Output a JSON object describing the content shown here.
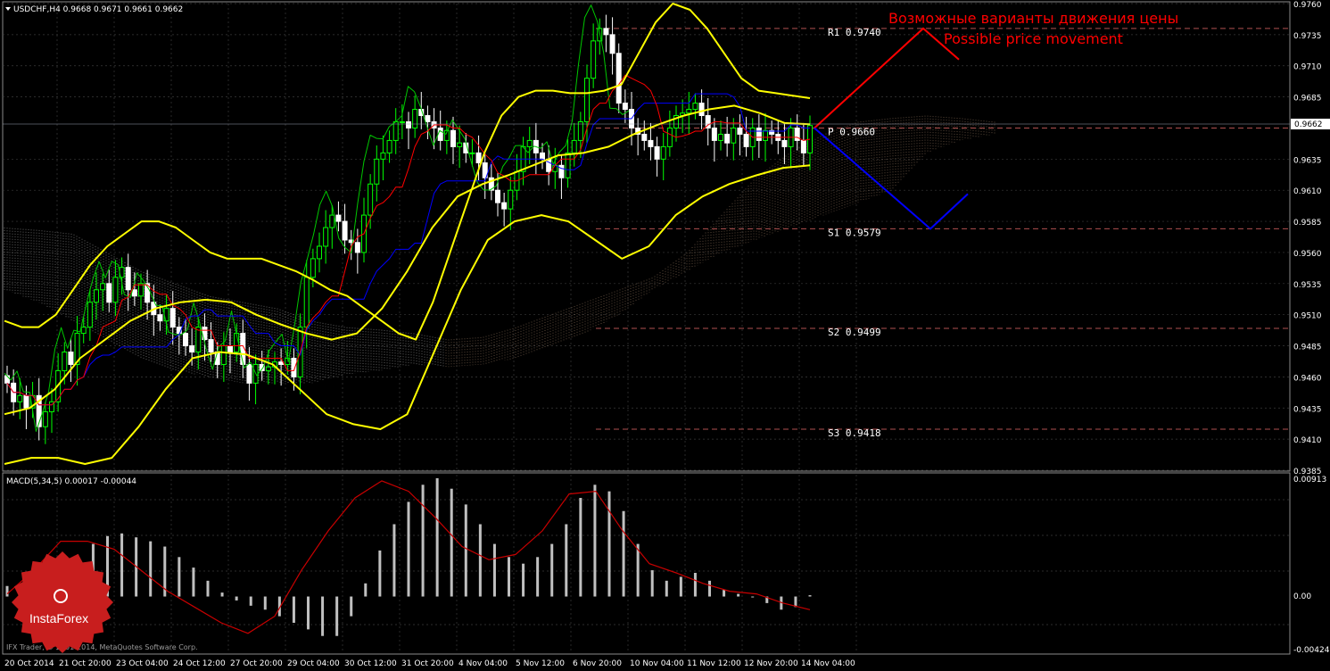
{
  "header": {
    "symbol_line": "USDCHF,H4  0.9668 0.9671 0.9661 0.9662"
  },
  "annotations": {
    "ru": "Возможные варианты движения цены",
    "en": "Possible price movement"
  },
  "levels": [
    {
      "name": "R1",
      "value": 0.974,
      "label": "R1 0.9740"
    },
    {
      "name": "P",
      "value": 0.966,
      "label": "P 0.9660"
    },
    {
      "name": "S1",
      "value": 0.9579,
      "label": "S1 0.9579"
    },
    {
      "name": "S2",
      "value": 0.9499,
      "label": "S2 0.9499"
    },
    {
      "name": "S3",
      "value": 0.9418,
      "label": "S3 0.9418"
    }
  ],
  "current_price": "0.9662",
  "macd": {
    "title": "MACD(5,34,5) 0.00017 -0.00044",
    "y_labels": [
      "0.00913",
      "0.00",
      "-0.00424"
    ]
  },
  "copyright": "IFX Trader, © 2001-2014, MetaQuotes Software Corp.",
  "logo_text": "InstaForex",
  "colors": {
    "bg": "#000000",
    "grid": "#3a3a3a",
    "bull": "#00ff00",
    "bear": "#ffffff",
    "bollinger": "#ffff00",
    "tenkan": "#ff0000",
    "kijun": "#0000ff",
    "chikou": "#00c800",
    "cloud_a": "#c8a080",
    "cloud_b": "#b09070",
    "pivot": "#b05050",
    "macd_hist": "#c0c0c0",
    "macd_signal": "#c80000",
    "red_path": "#ff0000",
    "blue_path": "#0000ff"
  },
  "chart_data": {
    "type": "line",
    "title": "USDCHF,H4",
    "price_axis": {
      "ylim": [
        0.9385,
        0.976
      ],
      "ticks": [
        "0.9760",
        "0.9735",
        "0.9710",
        "0.9685",
        "0.9635",
        "0.9610",
        "0.9585",
        "0.9560",
        "0.9535",
        "0.9510",
        "0.9485",
        "0.9460",
        "0.9435",
        "0.9410",
        "0.9385"
      ]
    },
    "x_ticks": [
      "20 Oct 2014",
      "21 Oct 20:00",
      "23 Oct 04:00",
      "24 Oct 12:00",
      "27 Oct 20:00",
      "29 Oct 04:00",
      "30 Oct 12:00",
      "31 Oct 20:00",
      "4 Nov 04:00",
      "5 Nov 12:00",
      "6 Nov 20:00",
      "10 Nov 04:00",
      "11 Nov 12:00",
      "12 Nov 20:00",
      "14 Nov 04:00"
    ],
    "close": [
      0.9455,
      0.944,
      0.9445,
      0.9435,
      0.9445,
      0.942,
      0.9432,
      0.944,
      0.9465,
      0.948,
      0.947,
      0.9495,
      0.95,
      0.952,
      0.953,
      0.9535,
      0.952,
      0.954,
      0.9548,
      0.953,
      0.9525,
      0.9535,
      0.952,
      0.951,
      0.9505,
      0.9515,
      0.95,
      0.9495,
      0.9485,
      0.948,
      0.95,
      0.949,
      0.948,
      0.947,
      0.9485,
      0.948,
      0.9495,
      0.947,
      0.9455,
      0.947,
      0.9465,
      0.9468,
      0.9472,
      0.947,
      0.9475,
      0.946,
      0.95,
      0.954,
      0.9555,
      0.9565,
      0.958,
      0.959,
      0.9585,
      0.957,
      0.9568,
      0.956,
      0.959,
      0.9615,
      0.9635,
      0.964,
      0.965,
      0.9665,
      0.9665,
      0.966,
      0.9675,
      0.967,
      0.9665,
      0.966,
      0.965,
      0.9658,
      0.9645,
      0.9648,
      0.964,
      0.964,
      0.9632,
      0.962,
      0.961,
      0.96,
      0.9595,
      0.961,
      0.9625,
      0.9645,
      0.965,
      0.964,
      0.9635,
      0.9625,
      0.963,
      0.962,
      0.964,
      0.965,
      0.9665,
      0.97,
      0.973,
      0.974,
      0.9735,
      0.972,
      0.968,
      0.9675,
      0.966,
      0.9655,
      0.965,
      0.9645,
      0.9635,
      0.9645,
      0.966,
      0.967,
      0.9672,
      0.9675,
      0.968,
      0.967,
      0.966,
      0.965,
      0.9655,
      0.9648,
      0.966,
      0.9655,
      0.9645,
      0.966,
      0.965,
      0.9658,
      0.9655,
      0.965,
      0.9645,
      0.966,
      0.965,
      0.964,
      0.9662
    ],
    "bb_upper": [
      0.9505,
      0.95,
      0.95,
      0.951,
      0.953,
      0.955,
      0.9565,
      0.9575,
      0.9585,
      0.9585,
      0.958,
      0.957,
      0.956,
      0.9555,
      0.9555,
      0.9555,
      0.955,
      0.9545,
      0.9538,
      0.953,
      0.9525,
      0.9515,
      0.9505,
      0.9495,
      0.949,
      0.952,
      0.956,
      0.96,
      0.964,
      0.967,
      0.9685,
      0.969,
      0.969,
      0.9688,
      0.9688,
      0.969,
      0.9695,
      0.972,
      0.9745,
      0.976,
      0.9755,
      0.974,
      0.972,
      0.97,
      0.969,
      0.9688,
      0.9686,
      0.9684
    ],
    "bb_middle": [
      0.943,
      0.9435,
      0.945,
      0.9475,
      0.949,
      0.9505,
      0.9515,
      0.952,
      0.9522,
      0.952,
      0.951,
      0.9502,
      0.9495,
      0.949,
      0.9495,
      0.9515,
      0.9545,
      0.958,
      0.9605,
      0.9615,
      0.9622,
      0.963,
      0.9638,
      0.964,
      0.9645,
      0.9655,
      0.9663,
      0.967,
      0.9675,
      0.9678,
      0.9672,
      0.9664,
      0.9663
    ],
    "bb_lower": [
      0.939,
      0.9395,
      0.9395,
      0.939,
      0.9395,
      0.942,
      0.945,
      0.9475,
      0.948,
      0.9478,
      0.947,
      0.945,
      0.943,
      0.9422,
      0.9418,
      0.943,
      0.948,
      0.953,
      0.957,
      0.9585,
      0.959,
      0.9585,
      0.957,
      0.9555,
      0.9565,
      0.959,
      0.9605,
      0.9615,
      0.9622,
      0.9628,
      0.963
    ],
    "macd_hist": [
      0.0008,
      0.0009,
      0.001,
      0.0012,
      0.0015,
      0.0025,
      0.004,
      0.0046,
      0.0048,
      0.0045,
      0.0042,
      0.0038,
      0.003,
      0.0022,
      0.0012,
      0.0003,
      -0.0003,
      -0.0007,
      -0.001,
      -0.0015,
      -0.002,
      -0.0025,
      -0.003,
      -0.003,
      -0.0015,
      0.001,
      0.0035,
      0.0055,
      0.0072,
      0.0085,
      0.009,
      0.0082,
      0.007,
      0.0055,
      0.004,
      0.003,
      0.0025,
      0.003,
      0.004,
      0.0055,
      0.0075,
      0.0085,
      0.008,
      0.0065,
      0.004,
      0.002,
      0.0012,
      0.0015,
      0.0018,
      0.0012,
      0.0005,
      0.0002,
      0.0,
      -0.0005,
      -0.001,
      -0.0008,
      0.0001
    ],
    "macd_signal": [
      0.0002,
      0.002,
      0.0042,
      0.0042,
      0.0036,
      0.002,
      0.0004,
      -0.0008,
      -0.002,
      -0.0028,
      -0.0015,
      0.002,
      0.005,
      0.0075,
      0.0088,
      0.008,
      0.006,
      0.0038,
      0.0028,
      0.0032,
      0.005,
      0.0078,
      0.008,
      0.005,
      0.0025,
      0.0018,
      0.001,
      0.0004,
      0.0002,
      -0.0005,
      -0.001
    ],
    "red_path": [
      0.966,
      0.974,
      0.9715
    ],
    "blue_path": [
      0.966,
      0.9579,
      0.9607
    ],
    "grid": true
  }
}
